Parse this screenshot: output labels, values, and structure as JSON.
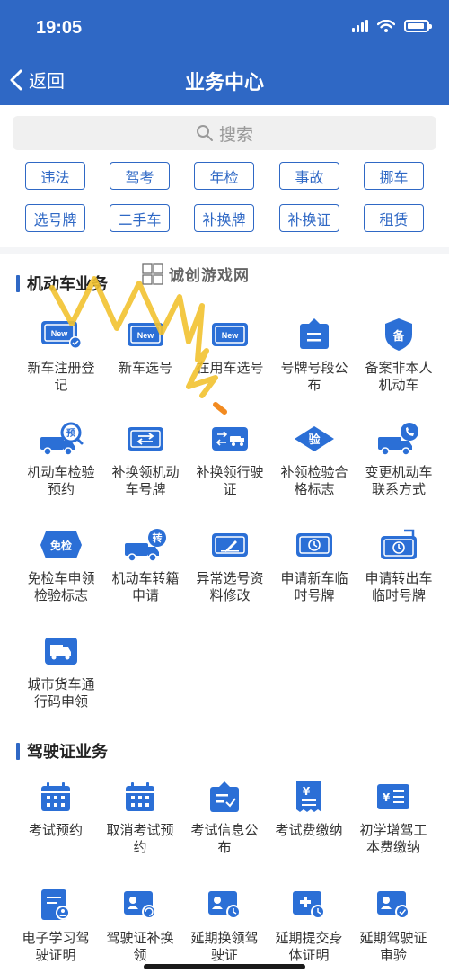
{
  "status": {
    "time": "19:05"
  },
  "header": {
    "back_label": "返回",
    "title": "业务中心"
  },
  "search": {
    "placeholder": "搜索"
  },
  "quick_tags": [
    "违法",
    "驾考",
    "年检",
    "事故",
    "挪车",
    "选号牌",
    "二手车",
    "补换牌",
    "补换证",
    "租赁"
  ],
  "watermark": {
    "text": "诚创游戏网"
  },
  "section_vehicle": {
    "title": "机动车业务",
    "items": [
      {
        "label": "新车注册登记",
        "icon": "new-plate-check-icon"
      },
      {
        "label": "新车选号",
        "icon": "new-plate-icon"
      },
      {
        "label": "在用车选号",
        "icon": "used-car-plate-icon"
      },
      {
        "label": "号牌号段公布",
        "icon": "announcement-board-icon"
      },
      {
        "label": "备案非本人机动车",
        "icon": "record-shield-icon"
      },
      {
        "label": "机动车检验预约",
        "icon": "inspection-appointment-icon"
      },
      {
        "label": "补换领机动车号牌",
        "icon": "plate-exchange-icon"
      },
      {
        "label": "补换领行驶证",
        "icon": "driving-license-exchange-icon"
      },
      {
        "label": "补领检验合格标志",
        "icon": "inspection-mark-icon"
      },
      {
        "label": "变更机动车联系方式",
        "icon": "change-contact-icon"
      },
      {
        "label": "免检车申领检验标志",
        "icon": "exempt-inspection-icon"
      },
      {
        "label": "机动车转籍申请",
        "icon": "vehicle-transfer-icon"
      },
      {
        "label": "异常选号资料修改",
        "icon": "edit-plate-icon"
      },
      {
        "label": "申请新车临时号牌",
        "icon": "temp-plate-icon"
      },
      {
        "label": "申请转出车临时号牌",
        "icon": "temp-plate-out-icon"
      },
      {
        "label": "城市货车通行码申领",
        "icon": "truck-pass-icon"
      }
    ]
  },
  "section_license": {
    "title": "驾驶证业务",
    "items": [
      {
        "label": "考试预约",
        "icon": "calendar-icon"
      },
      {
        "label": "取消考试预约",
        "icon": "calendar-cancel-icon"
      },
      {
        "label": "考试信息公布",
        "icon": "exam-info-icon"
      },
      {
        "label": "考试费缴纳",
        "icon": "fee-receipt-icon"
      },
      {
        "label": "初学增驾工本费缴纳",
        "icon": "fee-list-icon"
      },
      {
        "label": "电子学习驾驶证明",
        "icon": "e-learning-cert-icon"
      },
      {
        "label": "驾驶证补换领",
        "icon": "license-renew-icon"
      },
      {
        "label": "延期换领驾驶证",
        "icon": "license-delay-icon"
      },
      {
        "label": "延期提交身体证明",
        "icon": "health-cert-delay-icon"
      },
      {
        "label": "延期驾驶证审验",
        "icon": "license-review-delay-icon"
      }
    ]
  },
  "colors": {
    "primary": "#2f68c5",
    "icon_blue": "#2b6fd6",
    "bg_gray": "#f4f5f7"
  }
}
